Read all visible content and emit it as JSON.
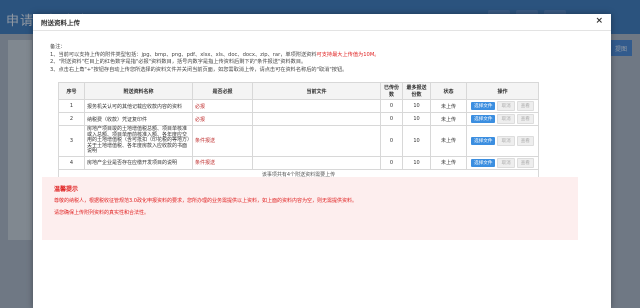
{
  "background": {
    "app_title": "申请语报申表",
    "right_button": "提图"
  },
  "modal": {
    "title": "附送资料上传",
    "close": "×",
    "notes_title": "备注：",
    "notes": [
      {
        "pre": "1、当前可以支持上传的附件类型包括：jpg、bmp、png、pdf、xlsx、xls、doc、docx、zip、rar，单项附送资料",
        "red": "可支持最大上传值为10M。",
        "post": ""
      },
      {
        "pre": "2、\"附送资料\"栏目上的红色数字是指\"必报\"资料数目，括号内数字是指上传资料后剩下的\"条件报送\"资料数目。",
        "red": "",
        "post": ""
      },
      {
        "pre": "3、点击右上角\"+\"按钮存自动上传您所选择的资料文件并关闭当前页面，如您需取消上传，请点击可在资料名称后的\"取消\"按钮。",
        "red": "",
        "post": ""
      }
    ],
    "table": {
      "headers": [
        "序号",
        "附送资料名称",
        "是否必报",
        "当前文件",
        "已传份数",
        "最多报送份数",
        "状态",
        "操作"
      ],
      "rows": [
        {
          "no": "1",
          "name": "报务机关认可的其他记载应收款内容的资料",
          "required": "必报",
          "file": "",
          "uploaded": "0",
          "max": "10",
          "status": "未上传"
        },
        {
          "no": "2",
          "name": "纳税费（收款）凭证复印件",
          "required": "必报",
          "file": "",
          "uploaded": "0",
          "max": "10",
          "status": "未上传"
        },
        {
          "no": "3",
          "name": "房地产项目竣的土地增值税总额、项目单核准或入总额、项目单册前核准入额、各年度应交用的土地增值税（含可抵扣（印花税的等地方）关于土地增值税、各年度房款入应收款的书面说明",
          "required": "条件报送",
          "file": "",
          "uploaded": "0",
          "max": "10",
          "status": "未上传"
        },
        {
          "no": "4",
          "name": "房地产企业是否存在应缴开发项目的说明",
          "required": "条件报送",
          "file": "",
          "uploaded": "0",
          "max": "10",
          "status": "未上传"
        }
      ],
      "btn_choose": "选择文件",
      "btn_cancel": "取消",
      "btn_preview": "查看",
      "summary": "该事项共有4个附送资料需要上传"
    },
    "tip": {
      "title": "温馨提示",
      "line1": "尊敬的纳税人，根据税收征管规范3.0政化申报资料的要求，您所办理的业务需提供以上资料，如上面的资料内容为空，则无需提供资料。",
      "line2": "请您确保上传附列资料的真实性和合法性。"
    }
  }
}
